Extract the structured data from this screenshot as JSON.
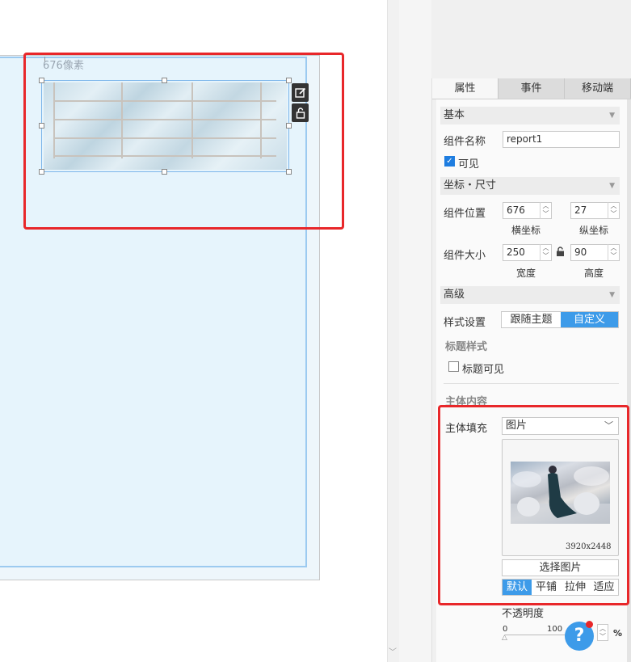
{
  "canvas": {
    "pixel_label": "676像素",
    "tools": {
      "edit_icon": "edit-icon",
      "lock_icon": "unlock-icon"
    }
  },
  "panel": {
    "tabs": [
      "属性",
      "事件",
      "移动端"
    ],
    "active_tab": "属性",
    "basic": {
      "title": "基本",
      "name_label": "组件名称",
      "name_value": "report1",
      "visible_label": "可见",
      "visible_checked": true
    },
    "geometry": {
      "title": "坐标・尺寸",
      "position_label": "组件位置",
      "x_value": "676",
      "y_value": "27",
      "x_caption": "横坐标",
      "y_caption": "纵坐标",
      "size_label": "组件大小",
      "width_value": "250",
      "height_value": "90",
      "width_caption": "宽度",
      "height_caption": "高度"
    },
    "advanced": {
      "title": "高级",
      "style_label": "样式设置",
      "style_options": [
        "跟随主题",
        "自定义"
      ],
      "style_selected": "自定义",
      "title_style_heading": "标题样式",
      "title_visible_label": "标题可见",
      "title_visible_checked": false,
      "body_heading": "主体内容",
      "fill_label": "主体填充",
      "fill_value": "图片",
      "image_size": "3920x2448",
      "choose_image_label": "选择图片",
      "fit_options": [
        "默认",
        "平铺",
        "拉伸",
        "适应"
      ],
      "fit_selected": "默认",
      "opacity_label": "不透明度",
      "opacity_min": "0",
      "opacity_value": "100",
      "opacity_unit": "%"
    }
  },
  "help": {
    "label": "?"
  },
  "colors": {
    "accent": "#3d9be9",
    "highlight": "#e8272a",
    "selection": "#7db6ea"
  }
}
